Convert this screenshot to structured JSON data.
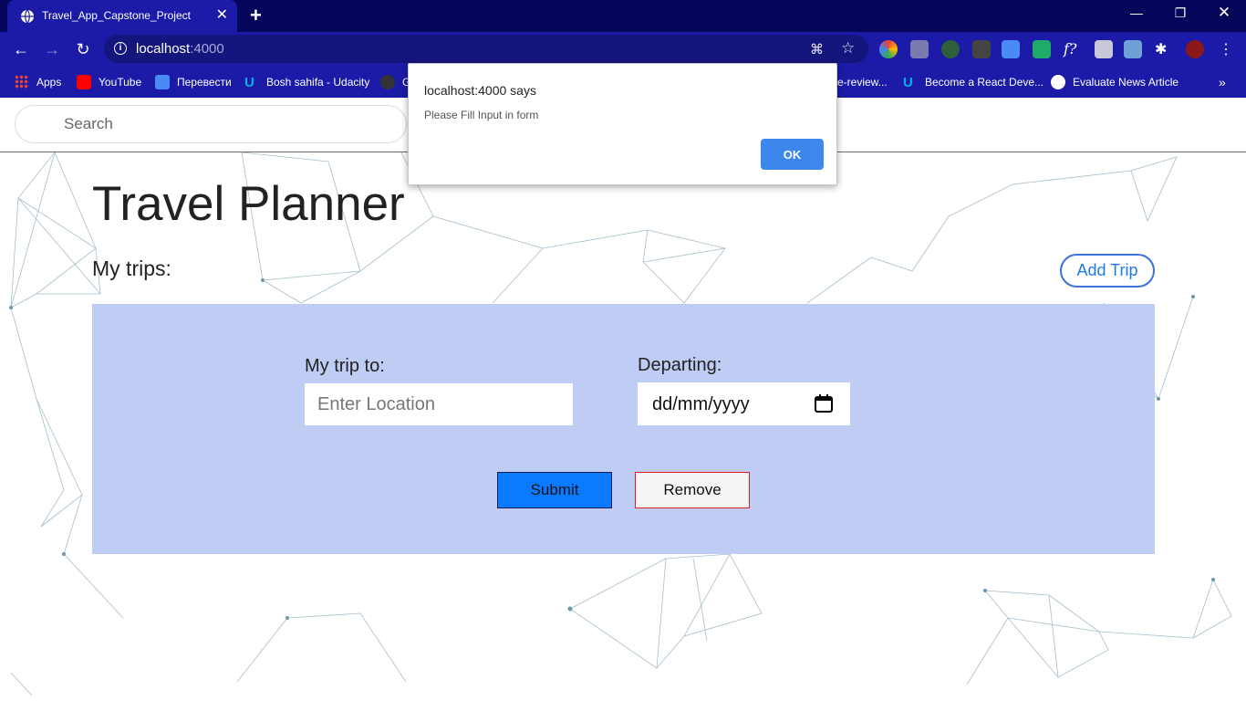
{
  "browser": {
    "tab_title": "Travel_App_Capstone_Project",
    "url_host": "localhost",
    "url_port": ":4000",
    "bookmarks": [
      {
        "label": "Apps",
        "icon": "apps-grid-icon",
        "color": "#e94235"
      },
      {
        "label": "YouTube",
        "icon": "youtube-icon",
        "color": "#ff0000"
      },
      {
        "label": "Перевести",
        "icon": "google-translate-icon",
        "color": "#4a8af4"
      },
      {
        "label": "Bosh sahifa - Udacity",
        "icon": "udacity-icon",
        "color": "#02b3e4"
      },
      {
        "label": "G",
        "icon": "github-icon",
        "color": "#333333"
      },
      {
        "label": "e-review...",
        "icon": "",
        "color": ""
      },
      {
        "label": "Become a React Deve...",
        "icon": "udacity-icon",
        "color": "#02b3e4"
      },
      {
        "label": "Evaluate News Article",
        "icon": "globe-icon",
        "color": "#ffffff"
      }
    ]
  },
  "page": {
    "search_placeholder": "Search",
    "title": "Travel Planner",
    "trips_label": "My trips:",
    "add_trip_label": "Add Trip",
    "form": {
      "destination_label": "My trip to:",
      "destination_placeholder": "Enter Location",
      "departing_label": "Departing:",
      "date_placeholder": "dd/mm/yyyy",
      "submit_label": "Submit",
      "remove_label": "Remove"
    }
  },
  "dialog": {
    "title": "localhost:4000 says",
    "message": "Please Fill Input in form",
    "ok_label": "OK"
  },
  "colors": {
    "browser_frame": "#1b1ba8",
    "form_panel": "#bfccf3",
    "submit_button": "#0a7bff",
    "remove_border": "#e02020",
    "add_trip_border": "#3d70d8"
  }
}
